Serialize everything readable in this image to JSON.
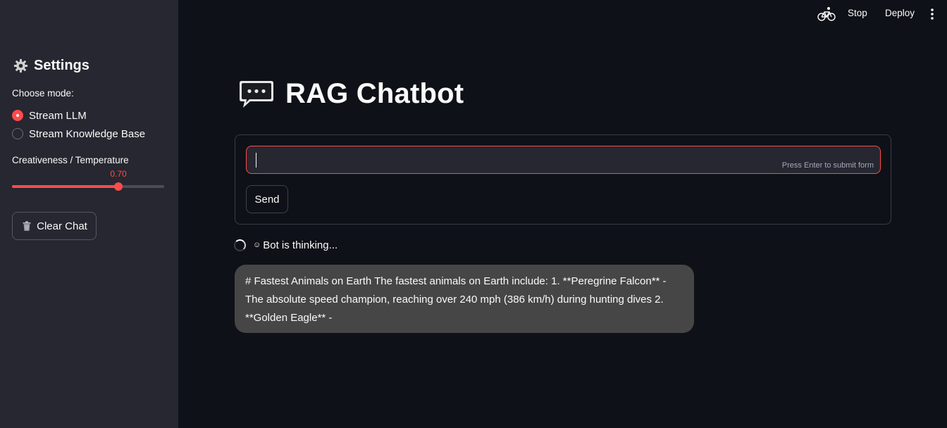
{
  "sidebar": {
    "title": "Settings",
    "mode_label": "Choose mode:",
    "modes": [
      {
        "label": "Stream LLM",
        "selected": true
      },
      {
        "label": "Stream Knowledge Base",
        "selected": false
      }
    ],
    "temperature": {
      "label": "Creativeness / Temperature",
      "value_text": "0.70",
      "value": 0.7,
      "fill_fraction": 0.7
    },
    "clear_label": "Clear Chat"
  },
  "topbar": {
    "stop_label": "Stop",
    "deploy_label": "Deploy"
  },
  "main": {
    "title": "RAG Chatbot",
    "input": {
      "value": "",
      "hint": "Press Enter to submit form"
    },
    "send_label": "Send",
    "status": "Bot is thinking...",
    "bot_message": "# Fastest Animals on Earth The fastest animals on Earth include: 1. **Peregrine Falcon** - The absolute speed champion, reaching over 240 mph (386 km/h) during hunting dives 2. **Golden Eagle** -"
  },
  "colors": {
    "accent": "#ff4b4b",
    "sidebar_bg": "#262730",
    "main_bg": "#0e1117",
    "bubble_bg": "#464646"
  },
  "icons": [
    "gear-icon",
    "trash-icon",
    "bicycle-icon",
    "kebab-menu-icon",
    "speech-bubble-icon",
    "spinner-icon",
    "robot-icon"
  ]
}
